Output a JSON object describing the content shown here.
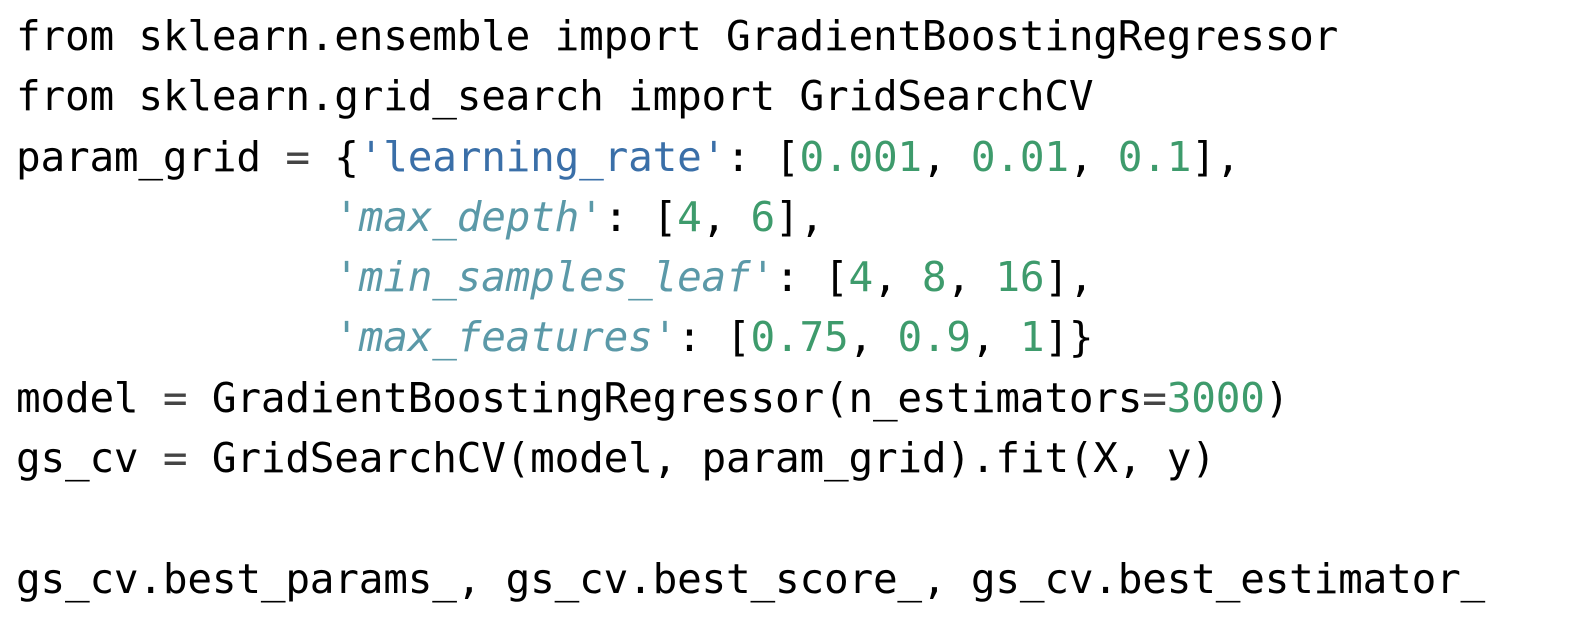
{
  "code": {
    "l1": {
      "kw_from": "from",
      "mod": " sklearn.ensemble ",
      "kw_import": "import",
      "name": " GradientBoostingRegressor"
    },
    "l2": {
      "kw_from": "from",
      "mod": " sklearn.grid_search ",
      "kw_import": "import",
      "name": " GridSearchCV"
    },
    "l3": {
      "pre": "param_grid ",
      "eq": "=",
      "open": " {",
      "key": "'learning_rate'",
      "colon": ": [",
      "v1": "0.001",
      "s1": ", ",
      "v2": "0.01",
      "s2": ", ",
      "v3": "0.1",
      "close": "],"
    },
    "l4": {
      "indent": "             ",
      "key": "'max_depth'",
      "colon": ": [",
      "v1": "4",
      "s1": ", ",
      "v2": "6",
      "close": "],"
    },
    "l5": {
      "indent": "             ",
      "key": "'min_samples_leaf'",
      "colon": ": [",
      "v1": "4",
      "s1": ", ",
      "v2": "8",
      "s2": ", ",
      "v3": "16",
      "close": "],"
    },
    "l6": {
      "indent": "             ",
      "key": "'max_features'",
      "colon": ": [",
      "v1": "0.75",
      "s1": ", ",
      "v2": "0.9",
      "s2": ", ",
      "v3": "1",
      "close": "]}"
    },
    "l7": {
      "pre": "model ",
      "eq": "=",
      "mid": " GradientBoostingRegressor(n_estimators",
      "eq2": "=",
      "num": "3000",
      "close": ")"
    },
    "l8": {
      "pre": "gs_cv ",
      "eq": "=",
      "rest": " GridSearchCV(model, param_grid).fit(X, y)"
    },
    "l10": {
      "text": "gs_cv.best_params_, gs_cv.best_score_, gs_cv.best_estimator_"
    }
  }
}
